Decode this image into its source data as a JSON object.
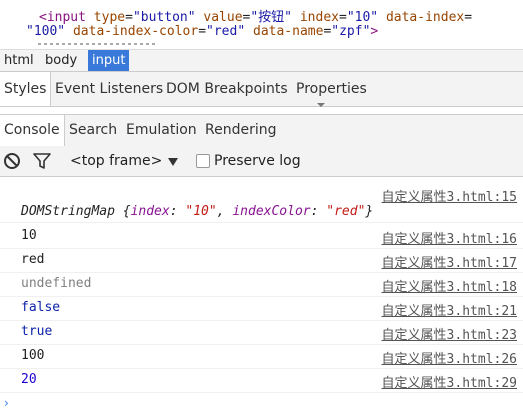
{
  "source": {
    "line1": {
      "open": "<input",
      "a1": "type",
      "v1": "\"button\"",
      "a2": "value",
      "v2": "\"按钮\"",
      "a3": "index",
      "v3": "\"10\"",
      "a4": "data-index",
      "eq": "="
    },
    "line2": {
      "v4": "\"100\"",
      "a5": "data-index-color",
      "v5": "\"red\"",
      "a6": "data-name",
      "v6": "\"zpf\"",
      "close": ">"
    }
  },
  "breadcrumb": [
    "html",
    "body",
    "input"
  ],
  "sidebar_tabs": [
    "Styles",
    "Event Listeners",
    "DOM Breakpoints",
    "Properties"
  ],
  "drawer_tabs": [
    "Console",
    "Search",
    "Emulation",
    "Rendering"
  ],
  "toolbar": {
    "clear_icon": "clear-console-icon",
    "filter_icon": "filter-icon",
    "frame": "<top frame>",
    "preserve_log": "Preserve log"
  },
  "messages": [
    {
      "source": "自定义属性3.html:15",
      "object": {
        "name": "DOMStringMap",
        "open": " {",
        "k1": "index",
        "sep1": ": ",
        "v1": "\"10\"",
        "comma": ", ",
        "k2": "indexColor",
        "sep2": ": ",
        "v2": "\"red\"",
        "close": "}"
      }
    },
    {
      "text": "10",
      "source": "自定义属性3.html:16"
    },
    {
      "text": "red",
      "source": "自定义属性3.html:17"
    },
    {
      "text": "undefined",
      "source": "自定义属性3.html:18"
    },
    {
      "text": "false",
      "source": "自定义属性3.html:21"
    },
    {
      "text": "true",
      "source": "自定义属性3.html:23"
    },
    {
      "text": "100",
      "source": "自定义属性3.html:26"
    },
    {
      "text": "20",
      "source": "自定义属性3.html:29"
    }
  ],
  "prompt": "›",
  "colors": {
    "accent": "#3879d9",
    "tag": "#881280",
    "attr": "#994500",
    "value": "#1a1aa6"
  }
}
